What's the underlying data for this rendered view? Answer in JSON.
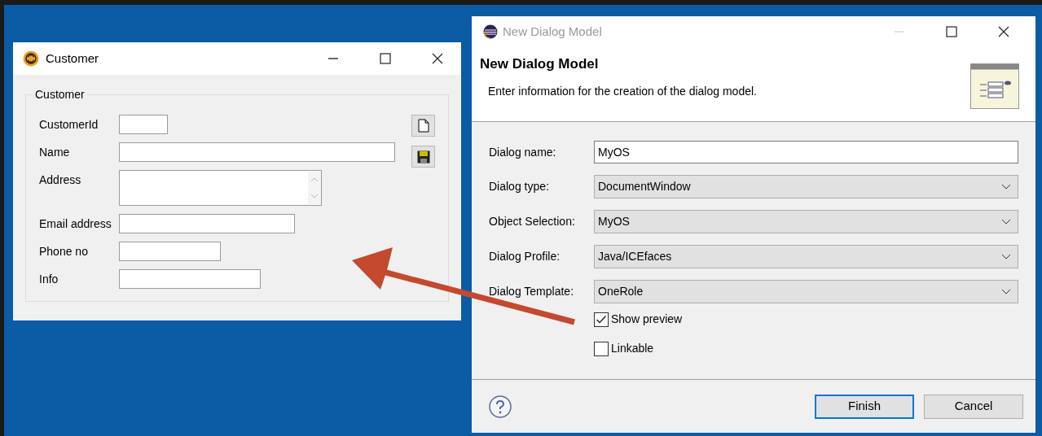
{
  "customer_window": {
    "title": "Customer",
    "group_label": "Customer",
    "fields": [
      {
        "label": "CustomerId",
        "kind": "text"
      },
      {
        "label": "Name",
        "kind": "text"
      },
      {
        "label": "Address",
        "kind": "textarea"
      },
      {
        "label": "Email address",
        "kind": "text"
      },
      {
        "label": "Phone no",
        "kind": "text"
      },
      {
        "label": "Info",
        "kind": "text"
      }
    ]
  },
  "dialog": {
    "title": "New Dialog Model",
    "minimize_disabled": true,
    "heading": "New Dialog Model",
    "description": "Enter information for the creation of the dialog model.",
    "fields": [
      {
        "label": "Dialog name:",
        "kind": "text",
        "value": "MyOS"
      },
      {
        "label": "Dialog type:",
        "kind": "dropdown",
        "value": "DocumentWindow"
      },
      {
        "label": "Object Selection:",
        "kind": "dropdown",
        "value": "MyOS"
      },
      {
        "label": "Dialog Profile:",
        "kind": "dropdown",
        "value": "Java/ICEfaces"
      },
      {
        "label": "Dialog Template:",
        "kind": "dropdown",
        "value": "OneRole"
      }
    ],
    "checkboxes": [
      {
        "label": "Show preview",
        "checked": true
      },
      {
        "label": "Linkable",
        "checked": false
      }
    ],
    "buttons": [
      {
        "label": "Finish",
        "default": true
      },
      {
        "label": "Cancel",
        "default": false
      }
    ]
  }
}
